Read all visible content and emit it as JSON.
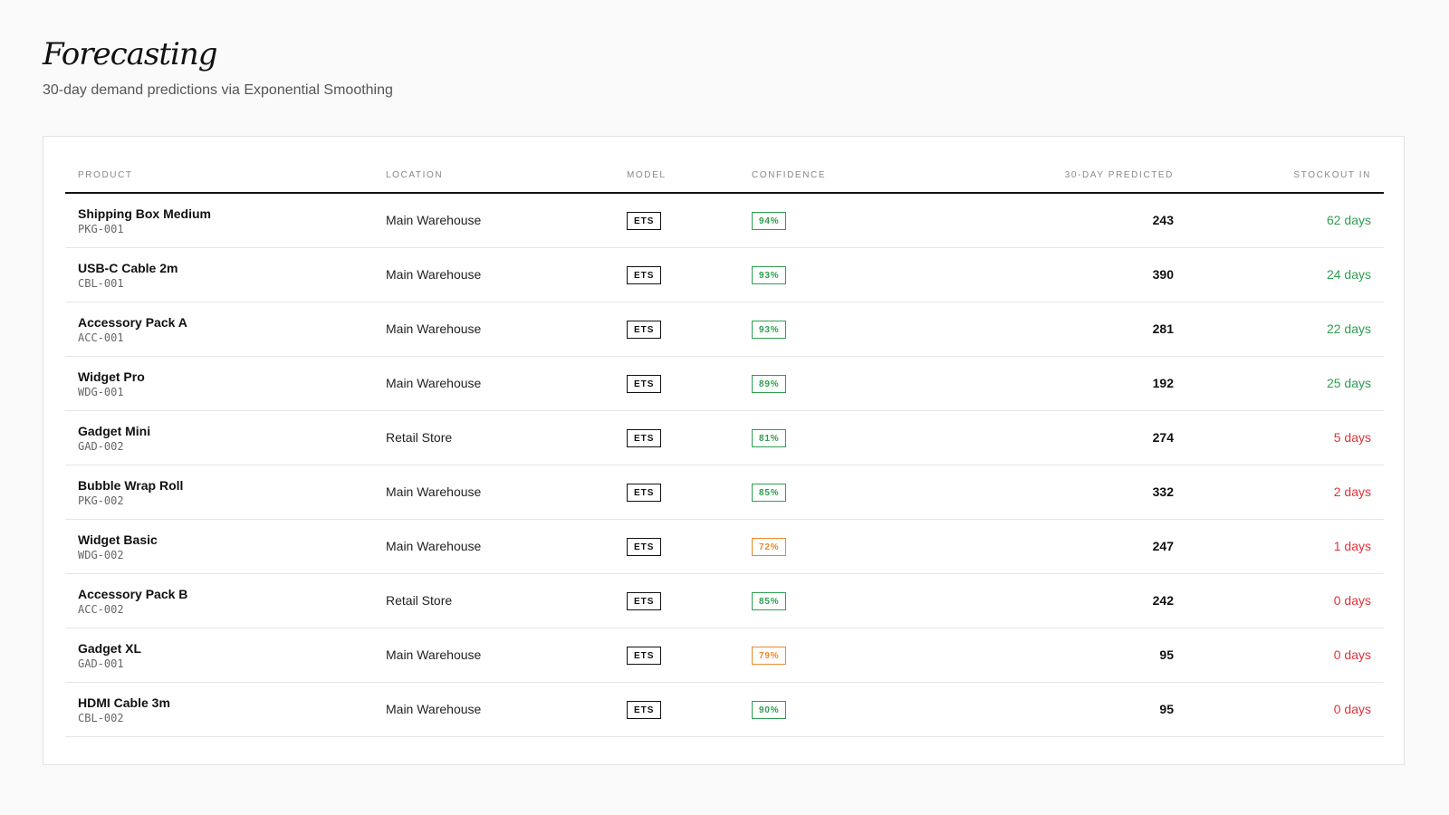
{
  "header": {
    "title": "Forecasting",
    "subtitle": "30-day demand predictions via Exponential Smoothing"
  },
  "table": {
    "columns": {
      "product": "PRODUCT",
      "location": "LOCATION",
      "model": "MODEL",
      "confidence": "CONFIDENCE",
      "predicted": "30-DAY PREDICTED",
      "stockout": "STOCKOUT IN"
    },
    "rows": [
      {
        "name": "Shipping Box Medium",
        "sku": "PKG-001",
        "location": "Main Warehouse",
        "model": "ETS",
        "confidence": "94%",
        "confidence_level": "high",
        "predicted": "243",
        "stockout": "62 days",
        "stockout_status": "ok"
      },
      {
        "name": "USB-C Cable 2m",
        "sku": "CBL-001",
        "location": "Main Warehouse",
        "model": "ETS",
        "confidence": "93%",
        "confidence_level": "high",
        "predicted": "390",
        "stockout": "24 days",
        "stockout_status": "ok"
      },
      {
        "name": "Accessory Pack A",
        "sku": "ACC-001",
        "location": "Main Warehouse",
        "model": "ETS",
        "confidence": "93%",
        "confidence_level": "high",
        "predicted": "281",
        "stockout": "22 days",
        "stockout_status": "ok"
      },
      {
        "name": "Widget Pro",
        "sku": "WDG-001",
        "location": "Main Warehouse",
        "model": "ETS",
        "confidence": "89%",
        "confidence_level": "high",
        "predicted": "192",
        "stockout": "25 days",
        "stockout_status": "ok"
      },
      {
        "name": "Gadget Mini",
        "sku": "GAD-002",
        "location": "Retail Store",
        "model": "ETS",
        "confidence": "81%",
        "confidence_level": "high",
        "predicted": "274",
        "stockout": "5 days",
        "stockout_status": "critical"
      },
      {
        "name": "Bubble Wrap Roll",
        "sku": "PKG-002",
        "location": "Main Warehouse",
        "model": "ETS",
        "confidence": "85%",
        "confidence_level": "high",
        "predicted": "332",
        "stockout": "2 days",
        "stockout_status": "critical"
      },
      {
        "name": "Widget Basic",
        "sku": "WDG-002",
        "location": "Main Warehouse",
        "model": "ETS",
        "confidence": "72%",
        "confidence_level": "medium",
        "predicted": "247",
        "stockout": "1 days",
        "stockout_status": "critical"
      },
      {
        "name": "Accessory Pack B",
        "sku": "ACC-002",
        "location": "Retail Store",
        "model": "ETS",
        "confidence": "85%",
        "confidence_level": "high",
        "predicted": "242",
        "stockout": "0 days",
        "stockout_status": "critical"
      },
      {
        "name": "Gadget XL",
        "sku": "GAD-001",
        "location": "Main Warehouse",
        "model": "ETS",
        "confidence": "79%",
        "confidence_level": "medium",
        "predicted": "95",
        "stockout": "0 days",
        "stockout_status": "critical"
      },
      {
        "name": "HDMI Cable 3m",
        "sku": "CBL-002",
        "location": "Main Warehouse",
        "model": "ETS",
        "confidence": "90%",
        "confidence_level": "high",
        "predicted": "95",
        "stockout": "0 days",
        "stockout_status": "critical"
      }
    ]
  },
  "colors": {
    "ok": "#2e9e50",
    "medium": "#ec8a2a",
    "critical": "#e0333a"
  }
}
